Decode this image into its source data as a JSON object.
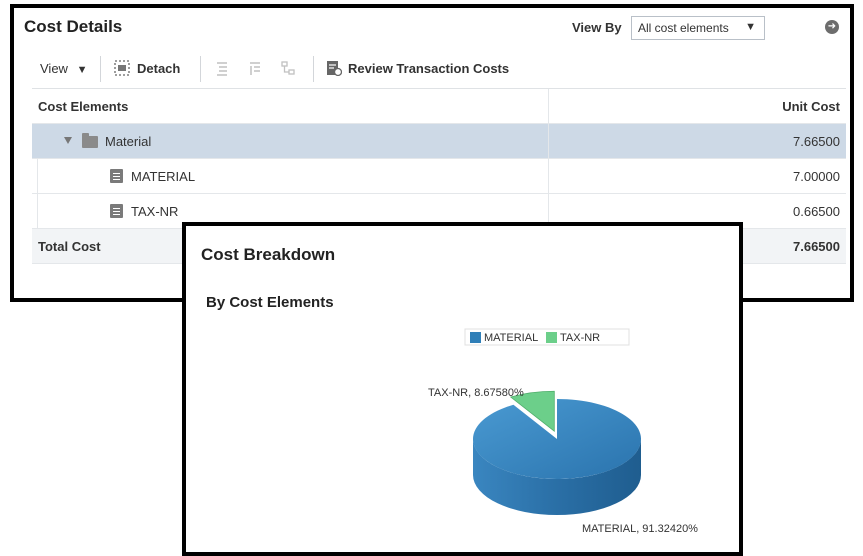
{
  "cost_details": {
    "title": "Cost Details",
    "view_by_label": "View By",
    "view_by_value": "All cost elements",
    "toolbar": {
      "view_label": "View",
      "detach_label": "Detach",
      "review_label": "Review Transaction Costs"
    },
    "columns": {
      "cost_elements": "Cost Elements",
      "unit_cost": "Unit Cost"
    },
    "rows": [
      {
        "name": "Material",
        "unit_cost": "7.66500"
      },
      {
        "name": "MATERIAL",
        "unit_cost": "7.00000"
      },
      {
        "name": "TAX-NR",
        "unit_cost": "0.66500"
      }
    ],
    "total": {
      "label": "Total Cost",
      "unit_cost": "7.66500"
    }
  },
  "cost_breakdown": {
    "title": "Cost Breakdown",
    "subtitle": "By Cost Elements"
  },
  "chart_data": {
    "type": "pie",
    "title": "By Cost Elements",
    "categories": [
      "MATERIAL",
      "TAX-NR"
    ],
    "values": [
      91.3242,
      8.6758
    ],
    "data_labels": [
      "MATERIAL, 91.32420%",
      "TAX-NR, 8.67580%"
    ],
    "colors": [
      "#2f7fb8",
      "#6ccf8a"
    ],
    "legend": "top"
  }
}
